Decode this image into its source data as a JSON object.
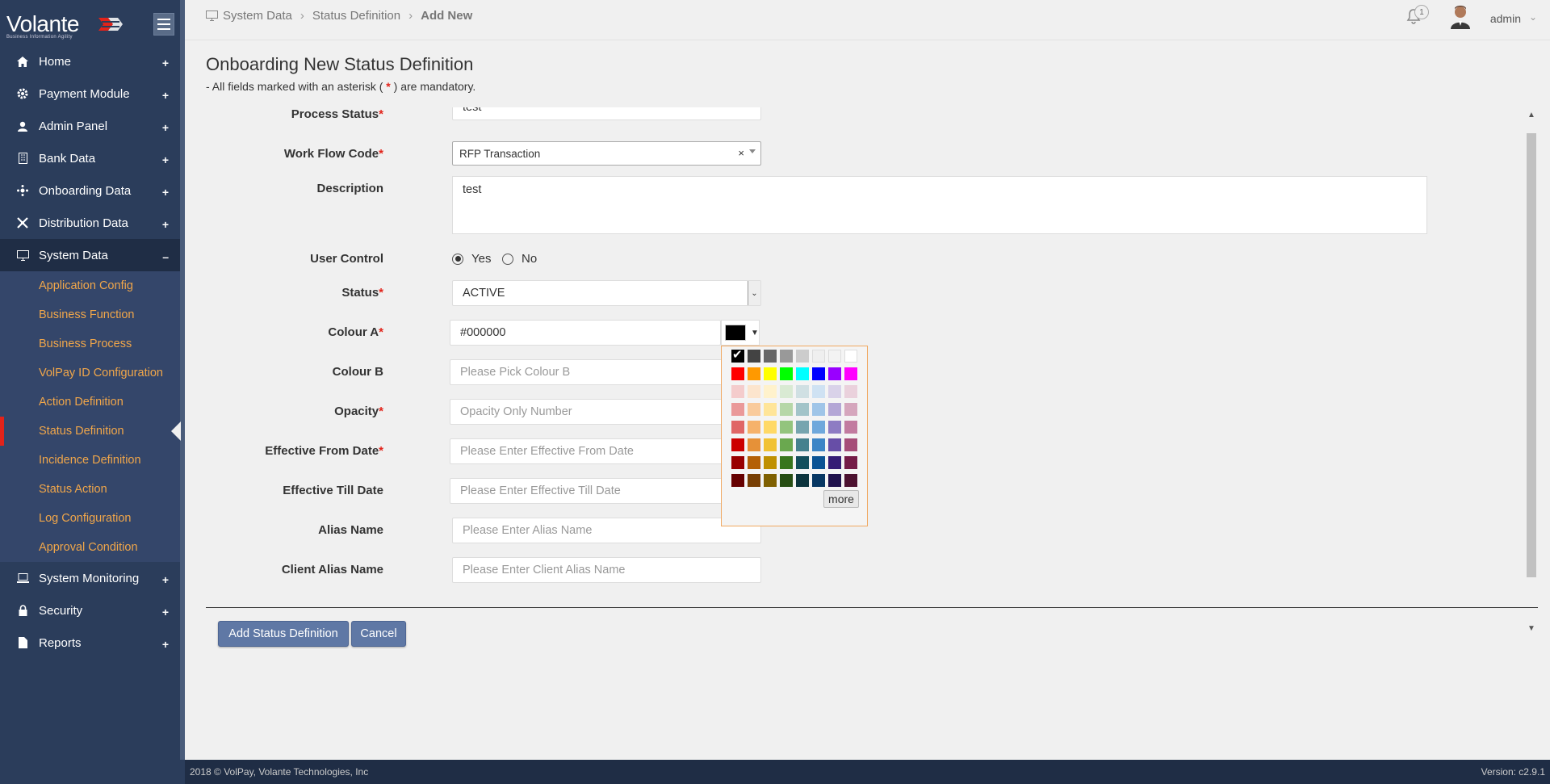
{
  "brand": {
    "logo_text": "Volante",
    "tagline": "Business Information Agility"
  },
  "breadcrumb": {
    "items": [
      "System Data",
      "Status Definition"
    ],
    "current": "Add New"
  },
  "header": {
    "notification_count": "1",
    "username": "admin"
  },
  "sidebar": {
    "items": [
      {
        "label": "Home",
        "icon": "home-icon"
      },
      {
        "label": "Payment Module",
        "icon": "gear-icon"
      },
      {
        "label": "Admin Panel",
        "icon": "user-icon"
      },
      {
        "label": "Bank Data",
        "icon": "building-icon"
      },
      {
        "label": "Onboarding Data",
        "icon": "network-icon"
      },
      {
        "label": "Distribution Data",
        "icon": "distribution-icon"
      },
      {
        "label": "System Data",
        "icon": "monitor-icon",
        "expanded": true
      }
    ],
    "system_data_children": [
      "Application Config",
      "Business Function",
      "Business Process",
      "VolPay ID Configuration",
      "Action Definition",
      "Status Definition",
      "Incidence Definition",
      "Status Action",
      "Log Configuration",
      "Approval Condition"
    ],
    "items_after": [
      {
        "label": "System Monitoring",
        "icon": "laptop-icon"
      },
      {
        "label": "Security",
        "icon": "lock-icon"
      },
      {
        "label": "Reports",
        "icon": "file-icon"
      }
    ],
    "expand_symbol": "+",
    "collapse_symbol": "–"
  },
  "page": {
    "title": "Onboarding New Status Definition",
    "note_prefix": "- All fields marked with an asterisk (",
    "note_star": "*",
    "note_suffix": ") are mandatory."
  },
  "form": {
    "process_status": {
      "label": "Process Status",
      "value": "test",
      "required": true
    },
    "work_flow_code": {
      "label": "Work Flow Code",
      "value": "RFP Transaction",
      "clear": "×",
      "required": true
    },
    "description": {
      "label": "Description",
      "value": "test"
    },
    "user_control": {
      "label": "User Control",
      "options": [
        "Yes",
        "No"
      ],
      "selected": "Yes"
    },
    "status": {
      "label": "Status",
      "value": "ACTIVE",
      "required": true
    },
    "colour_a": {
      "label": "Colour A",
      "value": "#000000",
      "required": true
    },
    "colour_b": {
      "label": "Colour B",
      "placeholder": "Please Pick Colour B"
    },
    "opacity": {
      "label": "Opacity",
      "placeholder": "Opacity Only Number",
      "required": true
    },
    "effective_from": {
      "label": "Effective From Date",
      "placeholder": "Please Enter Effective From Date",
      "required": true
    },
    "effective_till": {
      "label": "Effective Till Date",
      "placeholder": "Please Enter Effective Till Date"
    },
    "alias_name": {
      "label": "Alias Name",
      "placeholder": "Please Enter Alias Name"
    },
    "client_alias_name": {
      "label": "Client Alias Name",
      "placeholder": "Please Enter Client Alias Name"
    }
  },
  "palette": {
    "more_label": "more",
    "rows": [
      [
        "#000000",
        "#434343",
        "#666666",
        "#999999",
        "#cccccc",
        "#efefef",
        "#f3f3f3",
        "#ffffff"
      ],
      [
        "#ff0000",
        "#ff9900",
        "#ffff00",
        "#00ff00",
        "#00ffff",
        "#0000ff",
        "#9900ff",
        "#ff00ff"
      ],
      [
        "#f4cccc",
        "#fce5cd",
        "#fff2cc",
        "#d9ead3",
        "#d0e0e3",
        "#cfe2f3",
        "#d9d2e9",
        "#ead1dc"
      ],
      [
        "#ea9999",
        "#f9cb9c",
        "#ffe599",
        "#b6d7a8",
        "#a2c4c9",
        "#9fc5e8",
        "#b4a7d6",
        "#d5a6bd"
      ],
      [
        "#e06666",
        "#f6b26b",
        "#ffd966",
        "#93c47d",
        "#76a5af",
        "#6fa8dc",
        "#8e7cc3",
        "#c27ba0"
      ],
      [
        "#cc0000",
        "#e69138",
        "#f1c232",
        "#6aa84f",
        "#45818e",
        "#3d85c6",
        "#674ea7",
        "#a64d79"
      ],
      [
        "#990000",
        "#b45f06",
        "#bf9000",
        "#38761d",
        "#134f5c",
        "#0b5394",
        "#351c75",
        "#741b47"
      ],
      [
        "#660000",
        "#783f04",
        "#7f6000",
        "#274e13",
        "#0c343d",
        "#073763",
        "#20124d",
        "#4c1130"
      ]
    ]
  },
  "actions": {
    "submit": "Add Status Definition",
    "cancel": "Cancel"
  },
  "footer": {
    "copyright": "2018 © VolPay, Volante Technologies, Inc",
    "version": "Version: c2.9.1"
  },
  "colors": {
    "sidebar": "#2b3d5b",
    "accent": "#f0a64a",
    "required": "#e2231a",
    "button": "#5f78a5"
  }
}
